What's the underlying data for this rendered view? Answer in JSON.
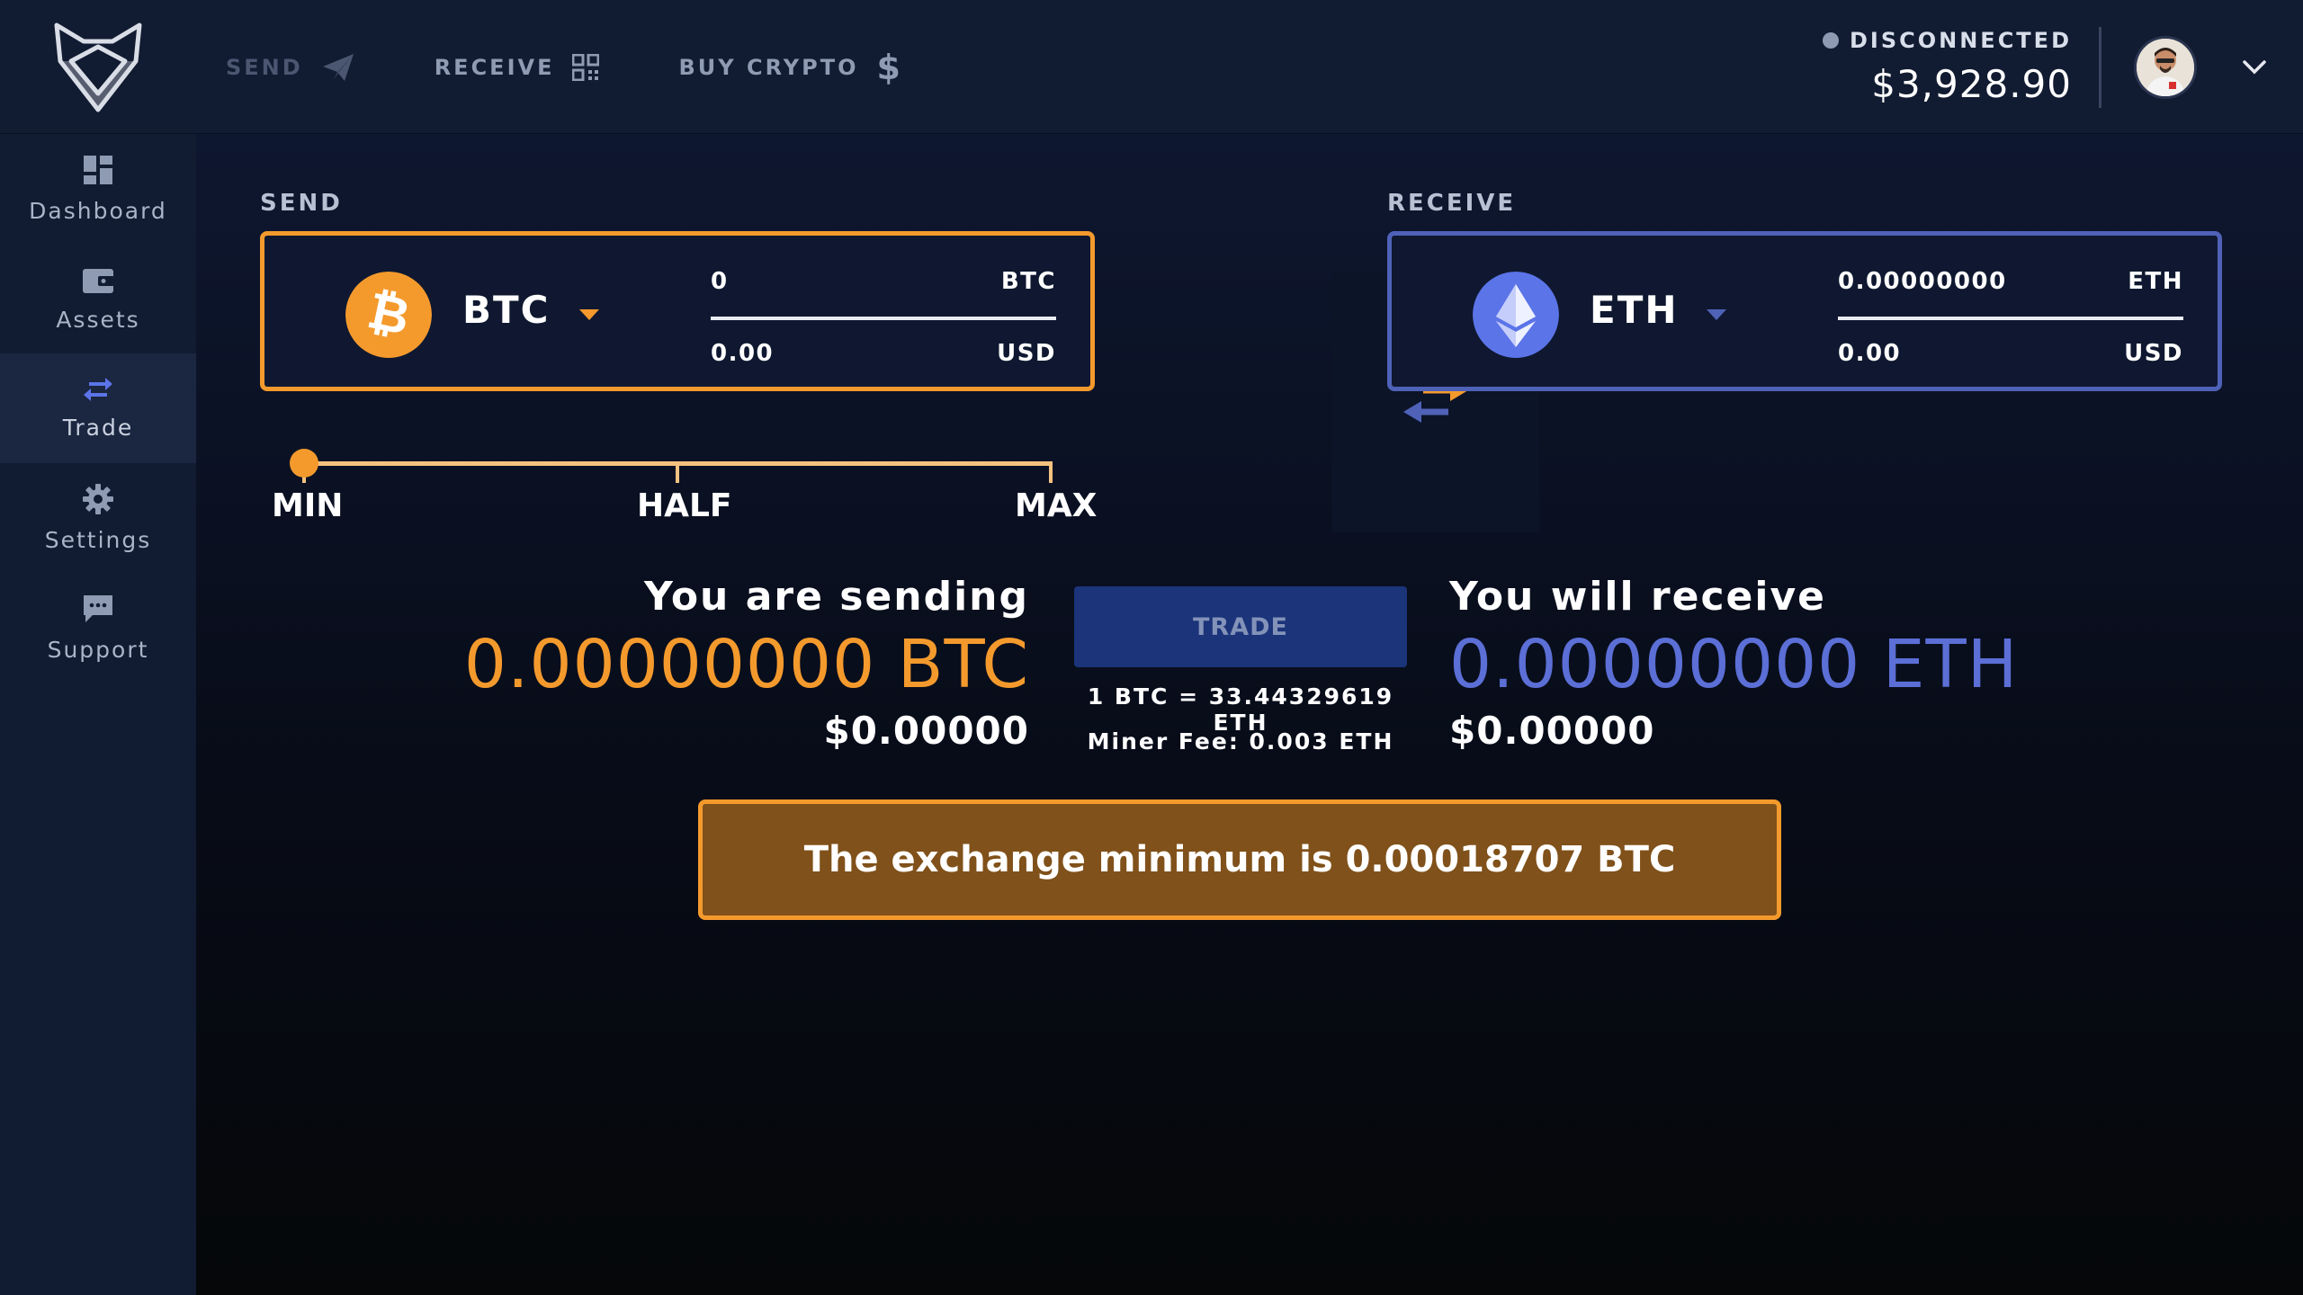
{
  "colors": {
    "btc_orange": "#f49a2d",
    "eth_indigo": "#4f62b8",
    "eth_text": "#5b6fd6",
    "warning_bg": "#80511a",
    "trade_button": "#1b347a"
  },
  "header": {
    "nav": {
      "send_label": "SEND",
      "receive_label": "RECEIVE",
      "buy_label": "BUY CRYPTO"
    },
    "status": "DISCONNECTED",
    "balance": "$3,928.90"
  },
  "sidebar": {
    "items": [
      {
        "label": "Dashboard",
        "icon": "dashboard-icon"
      },
      {
        "label": "Assets",
        "icon": "wallet-icon"
      },
      {
        "label": "Trade",
        "icon": "swap-icon",
        "active": true
      },
      {
        "label": "Settings",
        "icon": "gear-icon"
      },
      {
        "label": "Support",
        "icon": "chat-icon"
      }
    ]
  },
  "send": {
    "section_label": "SEND",
    "coin": "BTC",
    "crypto_amount": "0",
    "crypto_unit": "BTC",
    "fiat_amount": "0.00",
    "fiat_unit": "USD"
  },
  "receive": {
    "section_label": "RECEIVE",
    "coin": "ETH",
    "crypto_amount": "0.00000000",
    "crypto_unit": "ETH",
    "fiat_amount": "0.00",
    "fiat_unit": "USD"
  },
  "slider": {
    "min_label": "MIN",
    "half_label": "HALF",
    "max_label": "MAX",
    "value_fraction": 0
  },
  "summary": {
    "sending_title": "You are sending",
    "sending_amount": "0.00000000 BTC",
    "sending_usd": "$0.00000",
    "receiving_title": "You will receive",
    "receiving_amount": "0.00000000 ETH",
    "receiving_usd": "$0.00000"
  },
  "trade": {
    "button_label": "TRADE",
    "rate": "1 BTC = 33.44329619 ETH",
    "miner_fee": "Miner Fee: 0.003 ETH"
  },
  "warning": "The exchange minimum is 0.00018707 BTC"
}
